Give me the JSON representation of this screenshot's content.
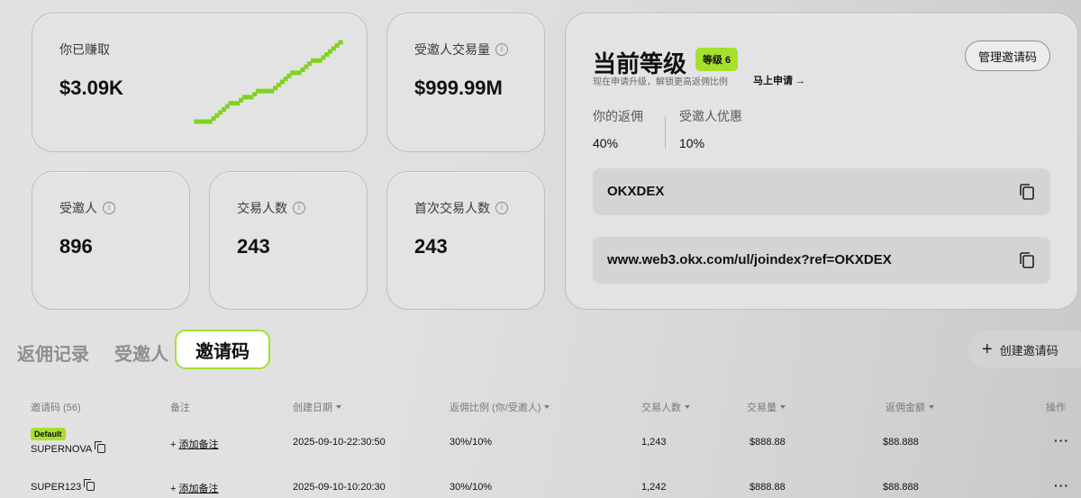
{
  "earned": {
    "label": "你已赚取",
    "value": "$3.09K"
  },
  "earned_trend": {
    "type": "line",
    "x": [
      0,
      1,
      2,
      3,
      4,
      5,
      6,
      7,
      8,
      9,
      10,
      11,
      12,
      13,
      14,
      15,
      16,
      17,
      18,
      19,
      20,
      21
    ],
    "y": [
      0,
      0,
      0,
      1,
      2,
      3,
      3,
      4,
      4,
      5,
      5,
      5,
      6,
      7,
      8,
      8,
      9,
      10,
      10,
      11,
      12,
      13
    ],
    "color": "#7ed321"
  },
  "volume": {
    "label": "受邀人交易量",
    "value": "$999.99M"
  },
  "invitees": {
    "label": "受邀人",
    "value": "896"
  },
  "traders": {
    "label": "交易人数",
    "value": "243"
  },
  "first_traders": {
    "label": "首次交易人数",
    "value": "243"
  },
  "level": {
    "title": "当前等级",
    "badge": "等级 6",
    "subtitle": "现在申请升级，解锁更高返佣比例",
    "apply_link": "马上申请 →",
    "manage_button": "管理邀请码",
    "your_rebate_label": "你的返佣",
    "your_rebate_value": "40%",
    "invitee_discount_label": "受邀人优惠",
    "invitee_discount_value": "10%",
    "code": "OKXDEX",
    "link": "www.web3.okx.com/ul/joindex?ref=OKXDEX"
  },
  "tabs": {
    "rebates": "返佣记录",
    "invitees": "受邀人",
    "codes": "邀请码"
  },
  "create_button": "创建邀请码",
  "table": {
    "headers": {
      "code": "邀请码 (56)",
      "note": "备注",
      "created": "创建日期",
      "ratio": "返佣比例 (你/受邀人)",
      "traders": "交易人数",
      "volume": "交易量",
      "rebate": "返佣金额",
      "actions": "操作"
    },
    "rows": [
      {
        "default_badge": "Default",
        "code": "SUPERNOVA",
        "note": "添加备注",
        "created": "2025-09-10-22:30:50",
        "ratio": "30%/10%",
        "traders": "1,243",
        "volume": "$888.88",
        "rebate": "$88.888",
        "more": "···"
      },
      {
        "code": "SUPER123",
        "note": "添加备注",
        "created": "2025-09-10-10:20:30",
        "ratio": "30%/10%",
        "traders": "1,242",
        "volume": "$888.88",
        "rebate": "$88.888",
        "more": "···"
      }
    ]
  },
  "colors": {
    "accent": "#a6e02e",
    "card": "#e3e3e3"
  }
}
